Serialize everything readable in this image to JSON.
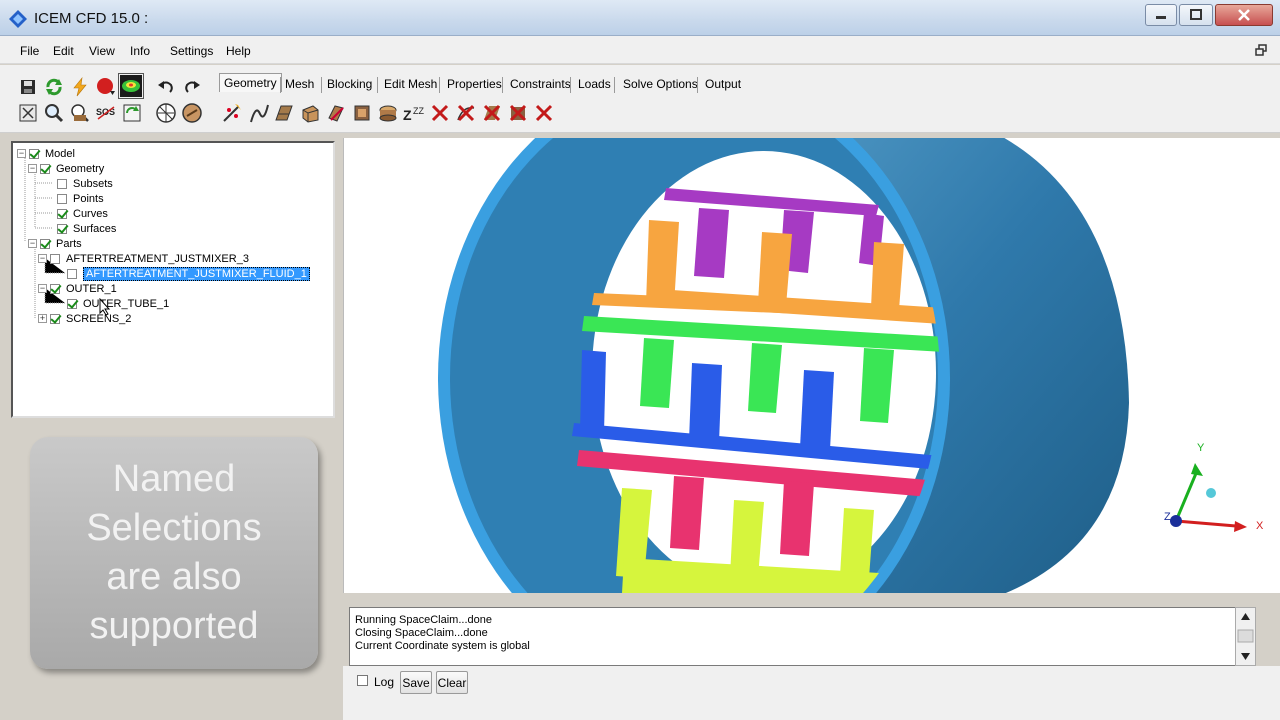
{
  "window": {
    "title": "ICEM CFD 15.0 :",
    "min_glyph": "–",
    "max_glyph": "□",
    "close_glyph": "✕"
  },
  "menu": {
    "items": [
      "File",
      "Edit",
      "View",
      "Info",
      "Settings",
      "Help"
    ]
  },
  "toolbar": {
    "tabs": [
      "Geometry",
      "Mesh",
      "Blocking",
      "Edit Mesh",
      "Properties",
      "Constraints",
      "Loads",
      "Solve Options",
      "Output"
    ],
    "active_tab": "Geometry",
    "sos_label": "SOS"
  },
  "tree": {
    "rows": [
      {
        "label": "Model",
        "checked": true
      },
      {
        "label": "Geometry",
        "checked": true
      },
      {
        "label": "Subsets",
        "checked": false
      },
      {
        "label": "Points",
        "checked": false
      },
      {
        "label": "Curves",
        "checked": true
      },
      {
        "label": "Surfaces",
        "checked": true
      },
      {
        "label": "Parts",
        "checked": true
      },
      {
        "label": "AFTERTREATMENT_JUSTMIXER_3",
        "checked": false
      },
      {
        "label": "AFTERTREATMENT_JUSTMIXER_FLUID_1",
        "checked": false,
        "selected": true
      },
      {
        "label": "OUTER_1",
        "checked": true
      },
      {
        "label": "OUTER_TUBE_1",
        "checked": true
      },
      {
        "label": "SCREENS_2",
        "checked": true
      }
    ]
  },
  "overlay": {
    "line1": "Named",
    "line2": "Selections",
    "line3": "are also",
    "line4": "supported"
  },
  "axes": {
    "x_label": "X",
    "y_label": "Y",
    "z_label": "Z"
  },
  "messages": {
    "lines": [
      "Running SpaceClaim...done",
      "Closing SpaceClaim...done",
      "Current Coordinate system is global"
    ],
    "log_label": "Log",
    "save_label": "Save",
    "clear_label": "Clear"
  },
  "colors": {
    "tube_outer": "#3a9fe0",
    "tube_inner": "#2f7fb3",
    "orange": "#f7a540",
    "purple": "#a63ac3",
    "green": "#3ae655",
    "blue": "#2a5ce8",
    "pink": "#e8336f",
    "yellow": "#d6f53d",
    "selection": "#3399ff"
  }
}
